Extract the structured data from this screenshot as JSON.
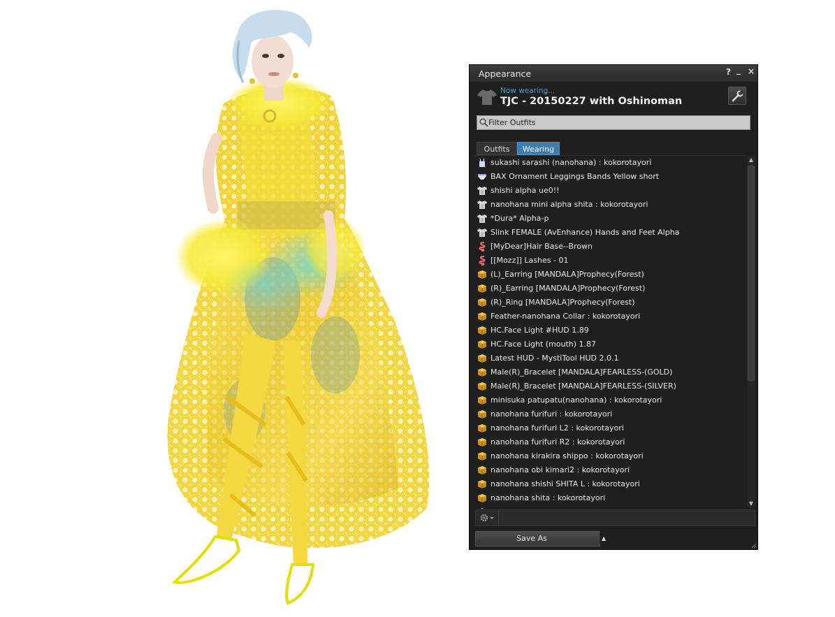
{
  "floater": {
    "title": "Appearance",
    "help_label": "?",
    "minimize_label": "_",
    "close_label": "×"
  },
  "header": {
    "now_wearing": "Now wearing...",
    "outfit_name": "TJC - 20150227 with Oshinoman",
    "icon": "shirt-icon"
  },
  "filter": {
    "placeholder": "Filter Outfits"
  },
  "tabs": [
    {
      "label": "Outfits",
      "active": false
    },
    {
      "label": "Wearing",
      "active": true
    }
  ],
  "items": [
    {
      "icon": "undershirt-icon",
      "label": "sukashi  sarashi (nanohana) : kokorotayori"
    },
    {
      "icon": "underpants-icon",
      "label": "BAX Ornament Leggings Bands Yellow short"
    },
    {
      "icon": "alpha-icon",
      "label": "shishi alpha ue0!!"
    },
    {
      "icon": "alpha-icon",
      "label": "nanohana mini alpha shita : kokorotayori"
    },
    {
      "icon": "alpha-icon",
      "label": "*Dura* Alpha-p"
    },
    {
      "icon": "alpha-icon",
      "label": "Slink FEMALE (AvEnhance) Hands and Feet Alpha"
    },
    {
      "icon": "hair-icon",
      "label": "[MyDear]Hair Base--Brown"
    },
    {
      "icon": "hair-icon",
      "label": "[[Mozz]] Lashes - 01"
    },
    {
      "icon": "object-icon",
      "label": "(L)_Earring [MANDALA]Prophecy(Forest)"
    },
    {
      "icon": "object-icon",
      "label": "(R)_Earring [MANDALA]Prophecy(Forest)"
    },
    {
      "icon": "object-icon",
      "label": "(R)_Ring [MANDALA]Prophecy(Forest)"
    },
    {
      "icon": "object-icon",
      "label": "Feather-nanohana Collar : kokorotayori"
    },
    {
      "icon": "object-icon",
      "label": "HC.Face Light  #HUD 1.89"
    },
    {
      "icon": "object-icon",
      "label": "HC.Face Light  (mouth) 1.87"
    },
    {
      "icon": "object-icon",
      "label": "Latest HUD - MystiTool HUD 2.0.1"
    },
    {
      "icon": "object-icon",
      "label": "Male(R)_Bracelet [MANDALA]FEARLESS-(GOLD)"
    },
    {
      "icon": "object-icon",
      "label": "Male(R)_Bracelet [MANDALA]FEARLESS-(SILVER)"
    },
    {
      "icon": "object-icon",
      "label": "minisuka patupatu(nanohana) : kokorotayori"
    },
    {
      "icon": "object-icon",
      "label": "nanohana furifuri : kokorotayori"
    },
    {
      "icon": "object-icon",
      "label": "nanohana furifuri L2 : kokorotayori"
    },
    {
      "icon": "object-icon",
      "label": "nanohana furifuri R2 : kokorotayori"
    },
    {
      "icon": "object-icon",
      "label": "nanohana kirakira shippo : kokorotayori"
    },
    {
      "icon": "object-icon",
      "label": "nanohana obi kimari2 : kokorotayori"
    },
    {
      "icon": "object-icon",
      "label": "nanohana shishi SHITA L : kokorotayori"
    },
    {
      "icon": "object-icon",
      "label": "nanohana shita : kokorotayori"
    },
    {
      "icon": "object-icon",
      "label": ""
    }
  ],
  "bottom": {
    "gear_icon": "gear-icon",
    "save_as_label": "Save As"
  },
  "colors": {
    "panel_bg": "#1f1f1f",
    "accent_blue": "#3b7fb5",
    "now_wearing_blue": "#3ca0dc",
    "dress_yellow": "#f2d21c",
    "dress_cyan": "#6fd0d8",
    "hair": "#c6dcec"
  }
}
